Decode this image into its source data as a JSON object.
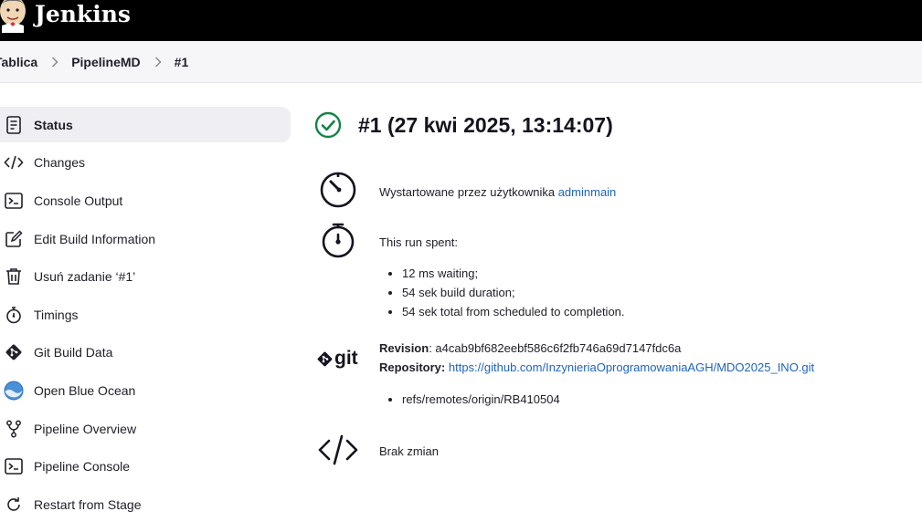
{
  "header": {
    "brand": "Jenkins"
  },
  "breadcrumb": {
    "items": [
      "Tablica",
      "PipelineMD",
      "#1"
    ]
  },
  "sidebar": {
    "items": [
      {
        "label": "Status",
        "icon": "status-icon"
      },
      {
        "label": "Changes",
        "icon": "code-icon"
      },
      {
        "label": "Console Output",
        "icon": "terminal-icon"
      },
      {
        "label": "Edit Build Information",
        "icon": "edit-icon"
      },
      {
        "label": "Usuń zadanie ‘#1’",
        "icon": "trash-icon"
      },
      {
        "label": "Timings",
        "icon": "stopwatch-icon"
      },
      {
        "label": "Git Build Data",
        "icon": "git-icon"
      },
      {
        "label": "Open Blue Ocean",
        "icon": "blue-ocean-icon"
      },
      {
        "label": "Pipeline Overview",
        "icon": "pipeline-icon"
      },
      {
        "label": "Pipeline Console",
        "icon": "terminal-icon"
      },
      {
        "label": "Restart from Stage",
        "icon": "restart-icon"
      }
    ]
  },
  "main": {
    "title": "#1 (27 kwi 2025, 13:14:07)",
    "started_by": {
      "prefix": "Wystartowane przez użytkownika",
      "user": "adminmain"
    },
    "timing": {
      "heading": "This run spent:",
      "items": [
        "12 ms waiting;",
        "54 sek build duration;",
        "54 sek total from scheduled to completion."
      ]
    },
    "git": {
      "logo_text": "git",
      "revision_label": "Revision",
      "revision": "a4cab9bf682eebf586c6f2fb746a69d7147fdc6a",
      "repository_label": "Repository",
      "repository": "https://github.com/InzynieriaOprogramowaniaAGH/MDO2025_INO.git",
      "branches": [
        "refs/remotes/origin/RB410504"
      ]
    },
    "changes": {
      "text": "Brak zmian"
    }
  },
  "colors": {
    "header_bg": "#000000",
    "success": "#138347",
    "link": "#1d63c4",
    "active_bg": "#efeff3"
  }
}
